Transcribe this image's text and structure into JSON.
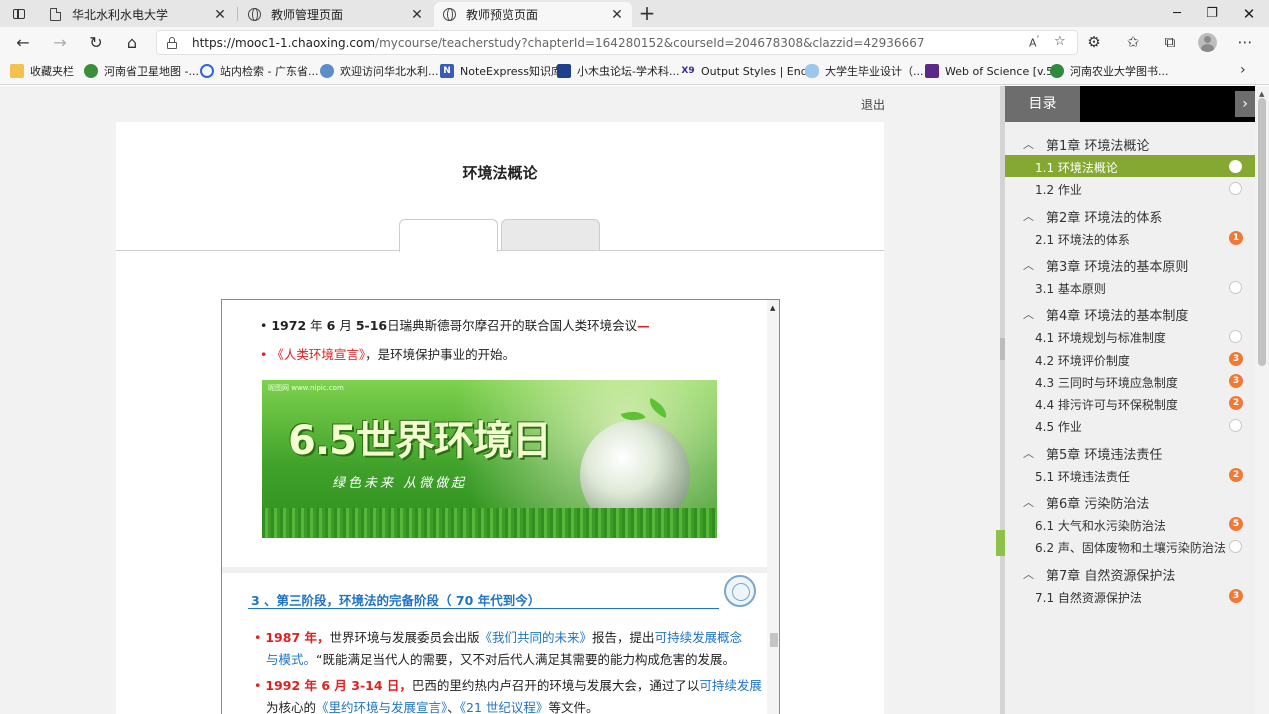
{
  "browser": {
    "tabs": [
      {
        "title": "华北水利水电大学",
        "icon": "document-icon",
        "active": false
      },
      {
        "title": "教师管理页面",
        "icon": "globe-icon",
        "active": false
      },
      {
        "title": "教师预览页面",
        "icon": "globe-icon",
        "active": true
      }
    ],
    "url_host": "https://mooc1-1.chaoxing.com",
    "url_path": "/mycourse/teacherstudy?chapterId=164280152&courseId=204678308&clazzid=42936667",
    "bookmarks": [
      {
        "label": "收藏夹栏",
        "icon": "folder-icon"
      },
      {
        "label": "河南省卫星地图 -...",
        "icon": "map-icon"
      },
      {
        "label": "站内检索 - 广东省...",
        "icon": "search-site-icon"
      },
      {
        "label": "欢迎访问华北水利...",
        "icon": "university-icon"
      },
      {
        "label": "NoteExpress知识库",
        "icon": "noteexpress-icon"
      },
      {
        "label": "小木虫论坛-学术科...",
        "icon": "muchong-icon"
      },
      {
        "label": "Output Styles | End...",
        "icon": "endnote-icon"
      },
      {
        "label": "大学生毕业设计（...",
        "icon": "cloud-icon"
      },
      {
        "label": "Web of Science [v.5...",
        "icon": "clarivate-icon"
      },
      {
        "label": "河南农业大学图书...",
        "icon": "library-icon"
      }
    ]
  },
  "page": {
    "logout": "退出",
    "course_title": "环境法概论",
    "slide1": {
      "line1": {
        "bullet": "•",
        "year": "1972",
        "y_unit": "年",
        "month": "6",
        "m_unit": "月",
        "days": "5-16",
        "text": "日瑞典斯德哥尔摩召开的联合国人类环境会议",
        "dash": "—"
      },
      "line2": {
        "bullet": "•",
        "highlight": "《人类环境宣言》",
        "text": "，是环境保护事业的开始。"
      },
      "banner": {
        "headline": "6.5世界环境日",
        "slogan": "绿色未来  从微做起",
        "watermark": "昵图网 www.nipic.com"
      }
    },
    "slide2": {
      "heading_prefix": "3 、第三阶段，环境法的完备阶段（",
      "heading_num": "70",
      "heading_suffix": "年代到今）",
      "p1_year": "1987 年，",
      "p1_text": "世界环境与发展委员会出版",
      "p1_book": "《我们共同的未来》",
      "p1_text2": "报告，提出",
      "p1_concept": "可持续发展概念",
      "p1_concept2": "与模式。",
      "p1_quote": "“既能满足当代人的需要，又不对后代人满足其需要的能力构成危害的发展。",
      "p2_date": "1992 年 6 月 3-14 日，",
      "p2_text": "巴西的里约热内卢召开的环境与发展大会，通过了以",
      "p2_concept": "可持续发展",
      "p2_text2": "为核心的",
      "p2_doc1": "《里约环境与发展宣言》",
      "p2_sep": "、",
      "p2_doc2": "《21 世纪议程》",
      "p2_end": "等文件。"
    }
  },
  "sidebar": {
    "tab_label": "目录",
    "chapters": [
      {
        "title": "第1章 环境法概论",
        "items": [
          {
            "label": "1.1 环境法概论",
            "badge": null,
            "active": true
          },
          {
            "label": "1.2 作业",
            "badge": null,
            "active": false
          }
        ]
      },
      {
        "title": "第2章 环境法的体系",
        "items": [
          {
            "label": "2.1 环境法的体系",
            "badge": "1",
            "active": false
          }
        ]
      },
      {
        "title": "第3章 环境法的基本原则",
        "items": [
          {
            "label": "3.1 基本原则",
            "badge": null,
            "active": false
          }
        ]
      },
      {
        "title": "第4章 环境法的基本制度",
        "items": [
          {
            "label": "4.1 环境规划与标准制度",
            "badge": null,
            "active": false
          },
          {
            "label": "4.2 环境评价制度",
            "badge": "3",
            "active": false
          },
          {
            "label": "4.3 三同时与环境应急制度",
            "badge": "3",
            "active": false
          },
          {
            "label": "4.4 排污许可与环保税制度",
            "badge": "2",
            "active": false
          },
          {
            "label": "4.5 作业",
            "badge": null,
            "active": false
          }
        ]
      },
      {
        "title": "第5章 环境违法责任",
        "items": [
          {
            "label": "5.1 环境违法责任",
            "badge": "2",
            "active": false
          }
        ]
      },
      {
        "title": "第6章 污染防治法",
        "items": [
          {
            "label": "6.1 大气和水污染防治法",
            "badge": "5",
            "active": false
          },
          {
            "label": "6.2 声、固体废物和土壤污染防治法",
            "badge": null,
            "active": false
          }
        ]
      },
      {
        "title": "第7章 自然资源保护法",
        "items": [
          {
            "label": "7.1 自然资源保护法",
            "badge": "3",
            "active": false
          }
        ]
      }
    ]
  },
  "colors": {
    "accent_green": "#84a832",
    "badge_orange": "#f07a35",
    "link_blue": "#1f74c6",
    "highlight_red": "#e02020"
  }
}
